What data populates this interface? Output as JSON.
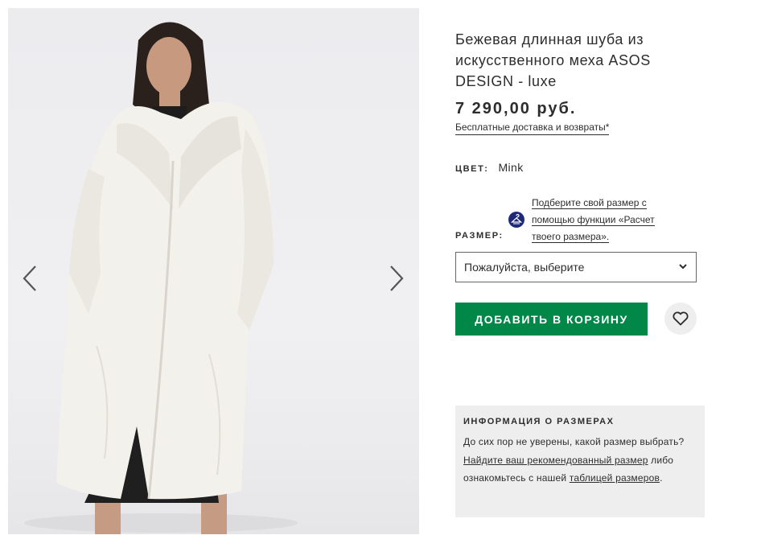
{
  "product": {
    "title": "Бежевая длинная шуба из искусственного меха ASOS DESIGN - luxe",
    "price": "7 290,00 руб.",
    "delivery_link": "Бесплатные доставка и возвраты*"
  },
  "color": {
    "label": "ЦВЕТ:",
    "value": "Mink"
  },
  "size": {
    "label": "РАЗМЕР:",
    "fit_link": "Подберите свой размер с помощью функции «Расчет твоего размера».",
    "select_value": "Пожалуйста, выберите"
  },
  "actions": {
    "add_to_bag": "ДОБАВИТЬ В КОРЗИНУ"
  },
  "size_info": {
    "heading": "ИНФОРМАЦИЯ О РАЗМЕРАХ",
    "text_1": "До сих пор не уверены, какой размер выбрать? ",
    "link_1": "Найдите ваш рекомендованный размер",
    "text_2": " либо ознакомьтесь с нашей ",
    "link_2": "таблицей размеров",
    "text_3": "."
  },
  "icons": {
    "prev": "chevron-left-icon",
    "next": "chevron-right-icon",
    "fit": "hanger-icon",
    "dropdown": "chevron-down-icon",
    "wishlist": "heart-icon"
  },
  "colors": {
    "accent_green": "#018849",
    "text": "#2d2d2d",
    "fit_icon_bg": "#1e2a78",
    "panel_bg": "#eeeeee"
  }
}
